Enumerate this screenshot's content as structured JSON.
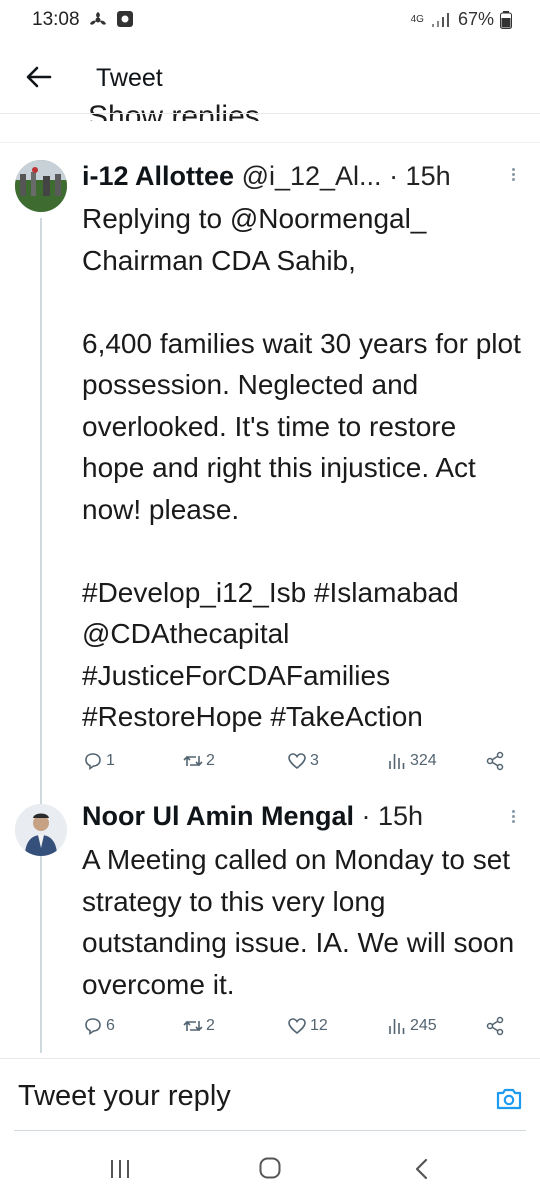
{
  "status_bar": {
    "time": "13:08",
    "battery": "67%",
    "network": "4G"
  },
  "header": {
    "title": "Tweet"
  },
  "show_replies": {
    "label": "Show replies"
  },
  "tweets": [
    {
      "name": "i-12 Allottee",
      "handle": "@i_12_Al...",
      "time": "· 15h",
      "reply_to": "Replying to @Noormengal_",
      "paragraphs": [
        "Chairman CDA Sahib,",
        "6,400 families wait 30 years for plot possession. Neglected and overlooked. It's time to restore hope and right this injustice. Act now! please.",
        "#Develop_i12_Isb #Islamabad @CDAthecapital #JusticeForCDAFamilies #RestoreHope #TakeAction"
      ],
      "replies": "1",
      "retweets": "2",
      "likes": "3",
      "views": "324"
    },
    {
      "name": "Noor Ul Amin Mengal",
      "time": "· 15h",
      "text": "A Meeting called on Monday to set strategy to this very long outstanding issue. IA. We will soon overcome it.",
      "replies": "6",
      "retweets": "2",
      "likes": "12",
      "views": "245"
    }
  ],
  "compose": {
    "placeholder": "Tweet your reply"
  },
  "colors": {
    "accent": "#1d9bf0",
    "text": "#0f1419",
    "muted": "#536471",
    "thread_line": "#cfd9de"
  }
}
